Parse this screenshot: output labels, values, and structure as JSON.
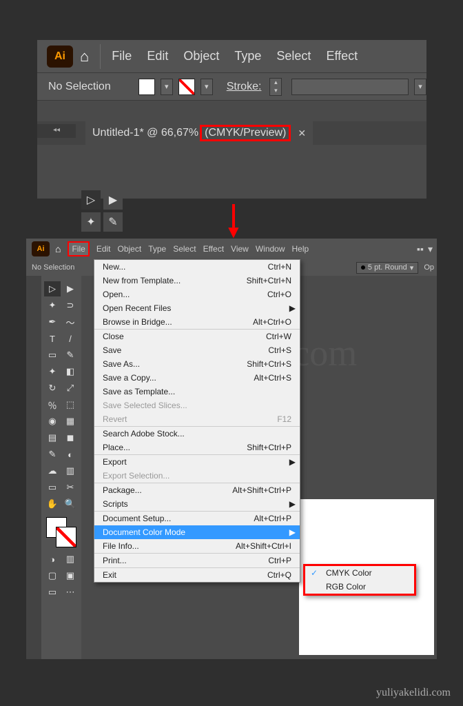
{
  "top": {
    "app": "Ai",
    "menu": [
      "File",
      "Edit",
      "Object",
      "Type",
      "Select",
      "Effect"
    ],
    "selection": "No Selection",
    "stroke_label": "Stroke:",
    "tab_prefix": "Untitled-1* @ 66,67% ",
    "tab_highlight": "(CMYK/Preview)",
    "collapse": "◂◂"
  },
  "arrow": "↓",
  "bot": {
    "menu": [
      "File",
      "Edit",
      "Object",
      "Type",
      "Select",
      "Effect",
      "View",
      "Window",
      "Help"
    ],
    "selection": "No Selection",
    "ptround": "5 pt. Round",
    "op_label": "Op"
  },
  "file_menu": [
    {
      "label": "New...",
      "shortcut": "Ctrl+N"
    },
    {
      "label": "New from Template...",
      "shortcut": "Shift+Ctrl+N"
    },
    {
      "label": "Open...",
      "shortcut": "Ctrl+O"
    },
    {
      "label": "Open Recent Files",
      "sub": true
    },
    {
      "label": "Browse in Bridge...",
      "shortcut": "Alt+Ctrl+O"
    },
    {
      "label": "Close",
      "shortcut": "Ctrl+W",
      "sep": true
    },
    {
      "label": "Save",
      "shortcut": "Ctrl+S"
    },
    {
      "label": "Save As...",
      "shortcut": "Shift+Ctrl+S"
    },
    {
      "label": "Save a Copy...",
      "shortcut": "Alt+Ctrl+S"
    },
    {
      "label": "Save as Template..."
    },
    {
      "label": "Save Selected Slices...",
      "disabled": true
    },
    {
      "label": "Revert",
      "shortcut": "F12",
      "disabled": true
    },
    {
      "label": "Search Adobe Stock...",
      "sep": true
    },
    {
      "label": "Place...",
      "shortcut": "Shift+Ctrl+P"
    },
    {
      "label": "Export",
      "sub": true,
      "sep": true
    },
    {
      "label": "Export Selection...",
      "disabled": true
    },
    {
      "label": "Package...",
      "shortcut": "Alt+Shift+Ctrl+P",
      "sep": true
    },
    {
      "label": "Scripts",
      "sub": true
    },
    {
      "label": "Document Setup...",
      "shortcut": "Alt+Ctrl+P",
      "sep": true
    },
    {
      "label": "Document Color Mode",
      "sub": true,
      "hl": true
    },
    {
      "label": "File Info...",
      "shortcut": "Alt+Shift+Ctrl+I"
    },
    {
      "label": "Print...",
      "shortcut": "Ctrl+P",
      "sep": true
    },
    {
      "label": "Exit",
      "shortcut": "Ctrl+Q",
      "sep": true
    }
  ],
  "submenu": [
    {
      "label": "CMYK Color",
      "checked": true
    },
    {
      "label": "RGB Color"
    }
  ],
  "watermark": "yuliyakelidi.com",
  "credit": "yuliyakelidi.com"
}
